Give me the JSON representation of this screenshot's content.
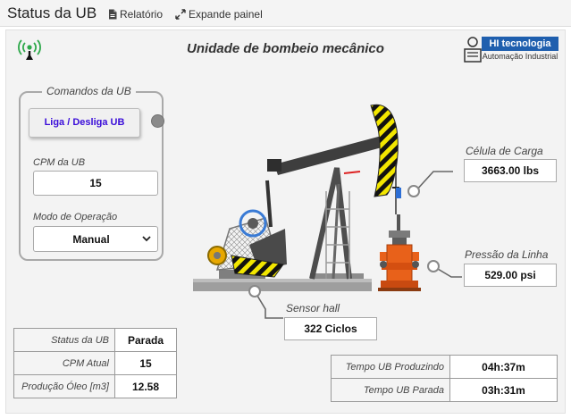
{
  "header": {
    "title": "Status da UB",
    "report_label": "Relatório",
    "expand_label": "Expande painel"
  },
  "panel": {
    "title": "Unidade de bombeio mecânico",
    "logo_brand": "HI tecnologia",
    "logo_sub": "Automação Industrial"
  },
  "commands": {
    "legend": "Comandos da UB",
    "toggle_button": "Liga / Desliga UB",
    "cpm_label": "CPM da UB",
    "cpm_value": "15",
    "mode_label": "Modo de Operação",
    "mode_value": "Manual"
  },
  "readouts": {
    "load_cell_label": "Célula de Carga",
    "load_cell_value": "3663.00 lbs",
    "line_pressure_label": "Pressão da Linha",
    "line_pressure_value": "529.00 psi",
    "hall_sensor_label": "Sensor hall",
    "hall_sensor_value": "322 Ciclos"
  },
  "status_table": [
    {
      "label": "Status da UB",
      "value": "Parada"
    },
    {
      "label": "CPM Atual",
      "value": "15"
    },
    {
      "label": "Produção Óleo [m3]",
      "value": "12.58"
    }
  ],
  "time_table": [
    {
      "label": "Tempo UB Produzindo",
      "value": "04h:37m"
    },
    {
      "label": "Tempo UB Parada",
      "value": "03h:31m"
    }
  ],
  "colors": {
    "accent_button_text": "#3a0dd9",
    "logo_blue": "#1f5fae",
    "signal_green": "#2da84a",
    "stripe_yellow": "#f2e600",
    "wellhead_orange": "#e8611a"
  },
  "icons": {
    "signal": "signal-tower-icon",
    "report": "document-icon",
    "expand": "expand-arrows-icon",
    "select_arrow": "chevron-down-icon"
  }
}
